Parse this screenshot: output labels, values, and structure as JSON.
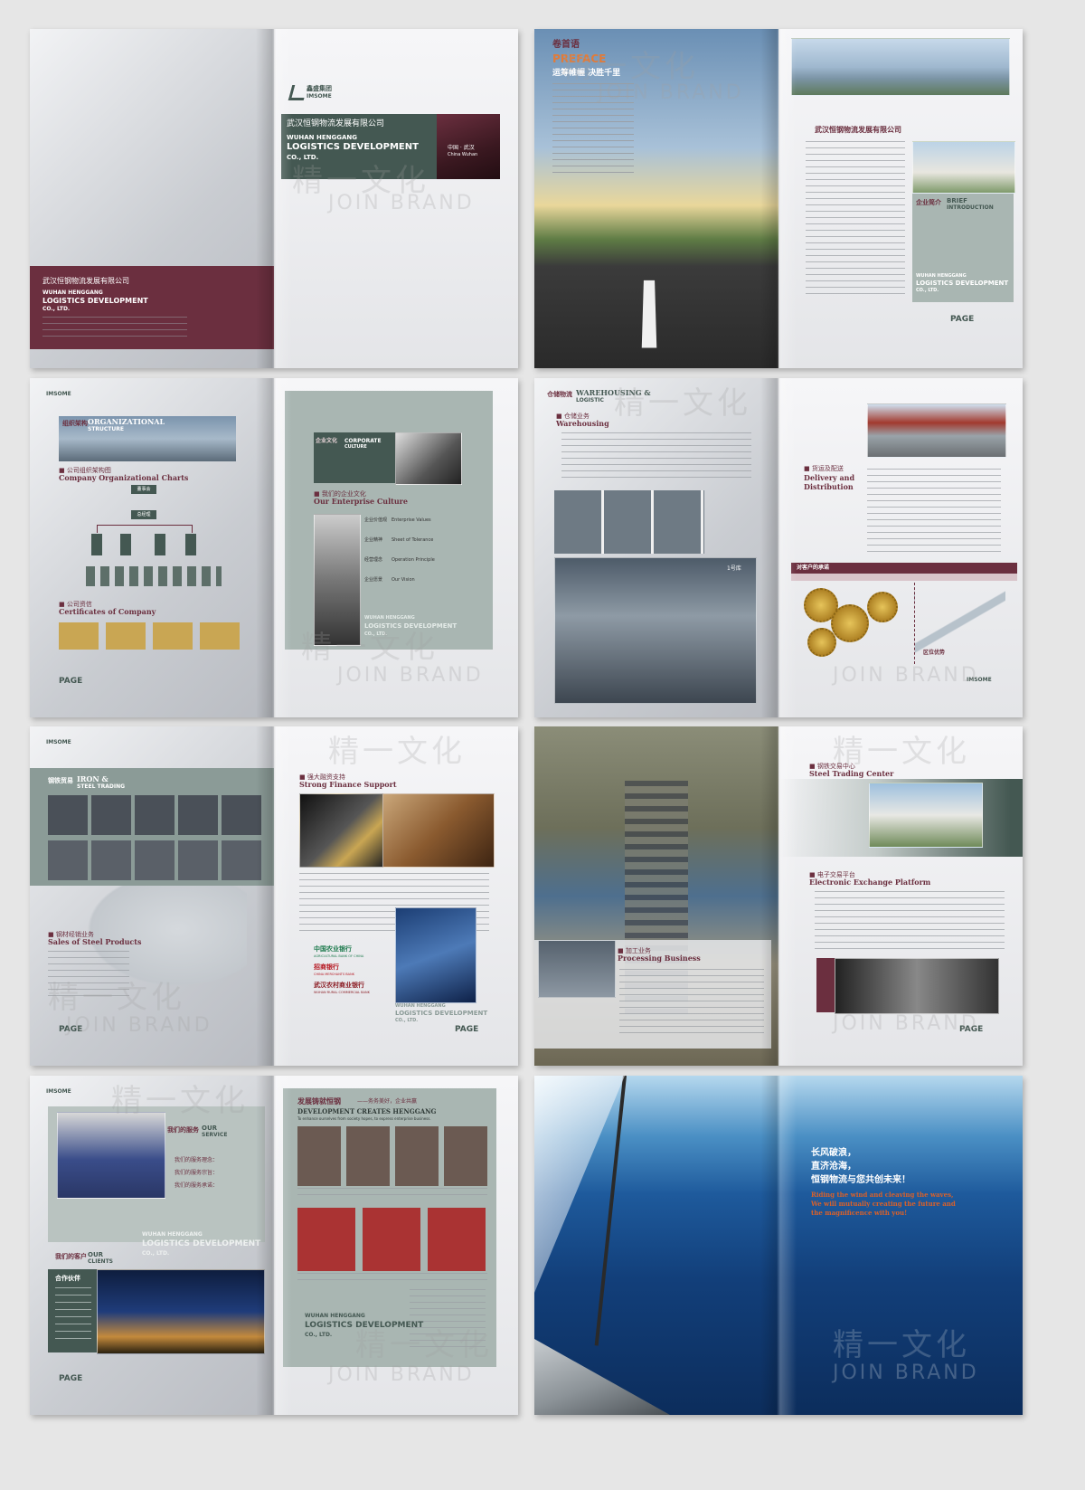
{
  "brand": {
    "company_cn": "武汉恒钢物流发展有限公司",
    "company_en_1": "WUHAN HENGGANG",
    "company_en_2": "LOGISTICS DEVELOPMENT",
    "company_en_3": "CO., LTD.",
    "logo_cn": "鑫盛集团",
    "logo_en": "IMSOME",
    "location_cn": "中国 · 武汉",
    "location_en": "China Wuhan",
    "page_label": "PAGE"
  },
  "watermark": {
    "cn": "精一文化",
    "en": "JOIN BRAND"
  },
  "preface": {
    "title_cn": "卷首语",
    "title_en": "PREFACE",
    "motto": "运筹帷幄  决胜千里",
    "intro_title": "武汉恒钢物流发展有限公司",
    "brief_cn": "企业简介",
    "brief_en_1": "BRIEF",
    "brief_en_2": "INTRODUCTION"
  },
  "org": {
    "header_cn": "组织架构",
    "header_en_1": "ORGANIZATIONAL",
    "header_en_2": "STRUCTURE",
    "chart_cn": "公司组织架构图",
    "chart_en": "Company Organizational Charts",
    "board": "董事会",
    "gm": "总经理",
    "cert_cn": "公司资信",
    "cert_en": "Certificates of Company"
  },
  "culture": {
    "header_cn": "企业文化",
    "header_en_1": "CORPORATE",
    "header_en_2": "CULTURE",
    "title_cn": "我们的企业文化",
    "title_en": "Our Enterprise Culture",
    "items": [
      {
        "cn": "企业价值观",
        "en": "Enterprise Values"
      },
      {
        "cn": "企业精神",
        "en": "Sheet of Tolerance"
      },
      {
        "cn": "经营理念",
        "en": "Operation Principle"
      },
      {
        "cn": "企业愿景",
        "en": "Our Vision"
      }
    ]
  },
  "warehousing": {
    "header_cn": "仓储物流",
    "header_en_1": "WAREHOUSING &",
    "header_en_2": "LOGISTIC",
    "title_cn": "仓储业务",
    "title_en": "Warehousing",
    "photo_label": "1号库",
    "delivery_cn": "货运及配送",
    "delivery_en_1": "Delivery and",
    "delivery_en_2": "Distribution",
    "promise": "对客户的承诺",
    "location": "区位优势"
  },
  "steel": {
    "header_cn": "钢铁贸易",
    "header_en_1": "IRON &",
    "header_en_2": "STEEL TRADING",
    "sales_cn": "钢材经销业务",
    "sales_en": "Sales of Steel Products",
    "finance_cn": "强大融资支持",
    "finance_en": "Strong Finance Support",
    "bank1_cn": "中国农业银行",
    "bank1_en": "AGRICULTURAL BANK OF CHINA",
    "bank2_cn": "招商银行",
    "bank2_en": "CHINA MERCHANTS BANK",
    "bank3_cn": "武汉农村商业银行",
    "bank3_en": "WUHAN RURAL COMMERCIAL BANK"
  },
  "processing": {
    "title_cn": "加工业务",
    "title_en": "Processing Business",
    "center_cn": "钢铁交易中心",
    "center_en": "Steel Trading Center",
    "platform_cn": "电子交易平台",
    "platform_en": "Electronic Exchange Platform"
  },
  "service": {
    "header_cn": "我们的服务",
    "header_en_1": "OUR",
    "header_en_2": "SERVICE",
    "lines": [
      "我们的服务理念：",
      "我们的服务宗旨：",
      "我们的服务承诺："
    ],
    "clients_cn": "我们的客户",
    "clients_en_1": "OUR",
    "clients_en_2": "CLIENTS",
    "partners": "合作伙伴",
    "dev_cn": "发展铸就恒钢",
    "dev_sub_cn": "——务务美好，企业共赢",
    "dev_en": "DEVELOPMENT CREATES HENGGANG",
    "dev_en_sub": "To enhance ourselves from society hopes, to express enterprise business."
  },
  "closing": {
    "line1": "长风破浪，",
    "line2": "直济沧海，",
    "line3": "恒钢物流与您共创未来！",
    "en1": "Riding the wind and cleaving the waves,",
    "en2": "We will mutually creating the future and",
    "en3": "the magnificence with you!"
  },
  "colors": {
    "teal": "#445852",
    "maroon": "#6b2f3f",
    "sage": "#a9b6b2",
    "accent_orange": "#d9612a"
  }
}
